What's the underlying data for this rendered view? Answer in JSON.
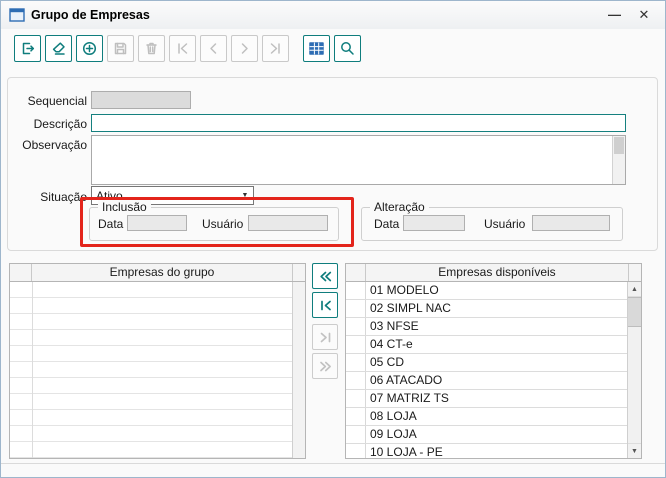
{
  "window": {
    "title": "Grupo de Empresas",
    "minimize_glyph": "—",
    "close_glyph": "✕"
  },
  "toolbar": {
    "buttons": [
      {
        "name": "exit",
        "icon": "exit-door-arrow-icon",
        "enabled": true
      },
      {
        "name": "clear",
        "icon": "eraser-icon",
        "enabled": true
      },
      {
        "name": "add",
        "icon": "plus-circle-icon",
        "enabled": true
      },
      {
        "name": "save",
        "icon": "floppy-disk-icon",
        "enabled": false
      },
      {
        "name": "delete",
        "icon": "trash-icon",
        "enabled": false
      },
      {
        "name": "first",
        "icon": "first-record-icon",
        "enabled": false
      },
      {
        "name": "prior",
        "icon": "prior-record-icon",
        "enabled": false
      },
      {
        "name": "next",
        "icon": "next-record-icon",
        "enabled": false
      },
      {
        "name": "last",
        "icon": "last-record-icon",
        "enabled": false
      },
      {
        "name": "grid",
        "icon": "table-grid-icon",
        "enabled": true
      },
      {
        "name": "search",
        "icon": "magnifier-icon",
        "enabled": true
      }
    ]
  },
  "form": {
    "sequencial": {
      "label": "Sequencial",
      "value": ""
    },
    "descricao": {
      "label": "Descrição",
      "value": ""
    },
    "observacao": {
      "label": "Observação",
      "value": ""
    },
    "situacao": {
      "label": "Situação",
      "value": "Ativo"
    }
  },
  "inclusao": {
    "title": "Inclusão",
    "data_label": "Data",
    "data_value": "",
    "usuario_label": "Usuário",
    "usuario_value": ""
  },
  "alteracao": {
    "title": "Alteração",
    "data_label": "Data",
    "data_value": "",
    "usuario_label": "Usuário",
    "usuario_value": ""
  },
  "group_table": {
    "header": "Empresas do grupo",
    "rows": []
  },
  "available_table": {
    "header": "Empresas disponíveis",
    "rows": [
      "01 MODELO",
      "02 SIMPL NAC",
      "03 NFSE",
      "04 CT-e",
      "05 CD",
      "06 ATACADO",
      "07 MATRIZ TS",
      "08 LOJA",
      "09 LOJA",
      "10 LOJA - PE"
    ]
  },
  "transfer": {
    "buttons": [
      {
        "name": "move-all-left",
        "icon": "double-chevron-left-icon",
        "enabled": true
      },
      {
        "name": "move-left",
        "icon": "bar-chevron-left-icon",
        "enabled": true
      },
      {
        "name": "move-right",
        "icon": "chevron-right-bar-icon",
        "enabled": false
      },
      {
        "name": "move-all-right",
        "icon": "double-chevron-right-icon",
        "enabled": false
      }
    ]
  },
  "icons": {
    "combo_arrow": "▼",
    "scroll_up": "▲",
    "scroll_down": "▼"
  },
  "colors": {
    "accent": "#0f7d7d",
    "highlight": "#e3241b",
    "grid_icon_fill": "#2e6db4"
  }
}
